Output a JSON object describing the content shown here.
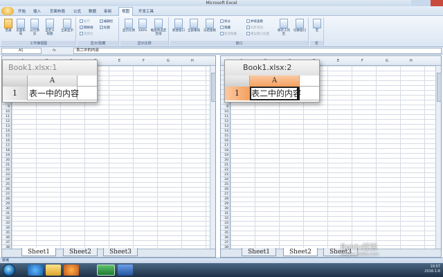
{
  "window": {
    "title": "Microsoft Excel"
  },
  "tabs": [
    "开始",
    "插入",
    "页面布局",
    "公式",
    "数据",
    "审阅",
    "视图",
    "开发工具"
  ],
  "active_tab_index": 6,
  "ribbon": {
    "groups": [
      {
        "label": "工作簿视图",
        "buttons": [
          "普通",
          "页面布局",
          "分页预览",
          "自定义视图",
          "全屏显示"
        ]
      },
      {
        "label": "显示/隐藏",
        "checks": [
          {
            "label": "标尺",
            "checked": false,
            "enabled": false
          },
          {
            "label": "编辑栏",
            "checked": true,
            "enabled": true
          },
          {
            "label": "网格线",
            "checked": true,
            "enabled": true
          },
          {
            "label": "标题",
            "checked": true,
            "enabled": true
          },
          {
            "label": "消息栏",
            "checked": false,
            "enabled": false
          }
        ]
      },
      {
        "label": "显示比例",
        "buttons": [
          "显示比例",
          "100%",
          "缩放到选定区域"
        ]
      },
      {
        "label": "窗口",
        "buttons": [
          "新建窗口",
          "全部重排",
          "冻结窗格",
          "保存工作区",
          "切换窗口"
        ],
        "small": [
          "拆分",
          "隐藏",
          "取消隐藏",
          "并排查看",
          "同步滚动",
          "重设窗口位置"
        ]
      },
      {
        "label": "宏",
        "buttons": [
          "宏"
        ]
      }
    ]
  },
  "formula_bar": {
    "name_box": "A1",
    "fx": "fx",
    "content": "表二中的内容"
  },
  "left_pane": {
    "columns": [
      "A",
      "B",
      "C",
      "D",
      "E",
      "F",
      "G",
      "H",
      "I"
    ],
    "sheets": [
      "Sheet1",
      "Sheet2",
      "Sheet3"
    ],
    "active_sheet": "Sheet1"
  },
  "right_pane": {
    "columns": [
      "A",
      "B",
      "C",
      "D",
      "E",
      "F",
      "G",
      "H",
      "I"
    ],
    "sheets": [
      "Sheet1",
      "Sheet2",
      "Sheet3"
    ],
    "active_sheet": "Sheet2"
  },
  "zoom_left": {
    "title": "Book1.xlsx:1",
    "col": "A",
    "row": "1",
    "cell": "表一中的内容"
  },
  "zoom_right": {
    "title": "Book1.xlsx:2",
    "col": "A",
    "row": "1",
    "cell": "表二中的内容"
  },
  "status": {
    "text": "就绪"
  },
  "taskbar": {
    "time": "10:57",
    "date": "2016-1-8"
  },
  "watermark": {
    "brand": "Baidu经验",
    "site": "jingyan.baidu.com"
  },
  "colors": {
    "accent": "#f5a060",
    "ribbon": "#dbe6f3",
    "close": "#c84a3d"
  }
}
